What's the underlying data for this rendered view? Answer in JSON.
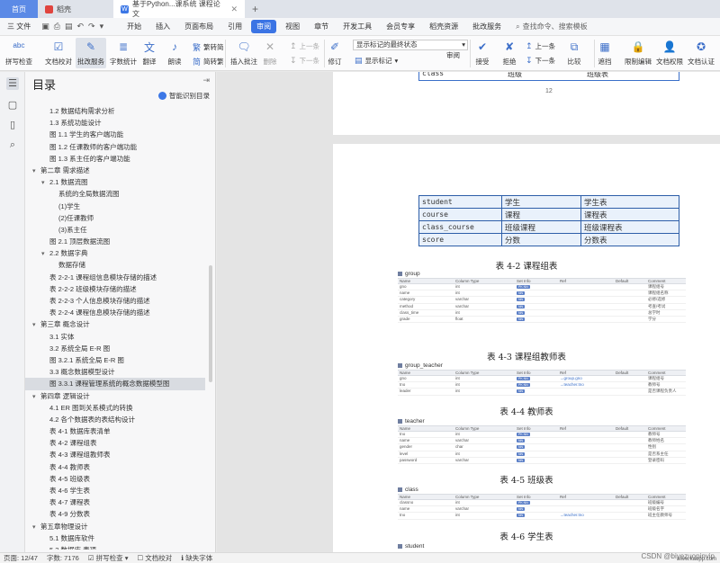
{
  "tabs": {
    "home": "首页",
    "shell": "稻壳",
    "doc": "基于Python...课系统 课程论文"
  },
  "menu": {
    "file": "三 文件",
    "items": [
      "开始",
      "插入",
      "页面布局",
      "引用",
      "审阅",
      "视图",
      "章节",
      "开发工具",
      "会员专享",
      "稻壳资源",
      "批改服务"
    ],
    "active_index": 4,
    "search": "查找命令、搜索模板"
  },
  "ribbon": {
    "spell": "拼写检查",
    "proof": "文档校对",
    "review_service": "批改服务",
    "word_count": "字数统计",
    "translate": "翻译",
    "read": "朗读",
    "trad": "繁转简",
    "simp": "简转繁",
    "insert_comment": "插入批注",
    "delete": "删除",
    "prev": "上一条",
    "next": "下一条",
    "revise": "修订",
    "display_select": "显示标记的最终状态",
    "show_marks": "显示标记",
    "review": "审阅",
    "accept": "接受",
    "reject": "拒绝",
    "prev2": "上一条",
    "next2": "下一条",
    "compare": "比较",
    "mask": "遮挡",
    "limit_edit": "限制编辑",
    "doc_permission": "文档权限",
    "doc_cert": "文档认证"
  },
  "toc": {
    "title": "目录",
    "smart": "智能识别目录",
    "items": [
      {
        "text": "1.2 数据结构需求分析",
        "level": 2,
        "arrow": ""
      },
      {
        "text": "1.3 系统功能设计",
        "level": 2,
        "arrow": ""
      },
      {
        "text": "图 1.1 学生的客户端功能",
        "level": 2,
        "arrow": ""
      },
      {
        "text": "图 1.2 任课教师的客户端功能",
        "level": 2,
        "arrow": ""
      },
      {
        "text": "图 1.3 系主任的客户端功能",
        "level": 2,
        "arrow": ""
      },
      {
        "text": "第二章 需求描述",
        "level": 1,
        "arrow": "▾"
      },
      {
        "text": "2.1 数据流图",
        "level": 2,
        "arrow": "▾"
      },
      {
        "text": "系统的全局数据流图",
        "level": 3,
        "arrow": ""
      },
      {
        "text": "(1)学生",
        "level": 3,
        "arrow": ""
      },
      {
        "text": "(2)任课教师",
        "level": 3,
        "arrow": ""
      },
      {
        "text": "(3)系主任",
        "level": 3,
        "arrow": ""
      },
      {
        "text": "图 2.1 顶层数据流图",
        "level": 2,
        "arrow": ""
      },
      {
        "text": "2.2 数据字典",
        "level": 2,
        "arrow": "▾"
      },
      {
        "text": "数据存储",
        "level": 3,
        "arrow": ""
      },
      {
        "text": "表 2-2-1 课程组信息模块存储的描述",
        "level": 2,
        "arrow": ""
      },
      {
        "text": "表 2-2-2 班级模块存储的描述",
        "level": 2,
        "arrow": ""
      },
      {
        "text": "表 2-2-3 个人信息模块存储的描述",
        "level": 2,
        "arrow": ""
      },
      {
        "text": "表 2-2-4 课程信息模块存储的描述",
        "level": 2,
        "arrow": ""
      },
      {
        "text": "第三章 概念设计",
        "level": 1,
        "arrow": "▾"
      },
      {
        "text": "3.1 实体",
        "level": 2,
        "arrow": ""
      },
      {
        "text": "3.2 系统全局 E-R 图",
        "level": 2,
        "arrow": ""
      },
      {
        "text": "图 3.2.1 系统全局 E-R 图",
        "level": 2,
        "arrow": ""
      },
      {
        "text": "3.3 概念数据模型设计",
        "level": 2,
        "arrow": ""
      },
      {
        "text": "图 3.3.1 课程管理系统的概念数据模型图",
        "level": 2,
        "arrow": "",
        "selected": true
      },
      {
        "text": "第四章 逻辑设计",
        "level": 1,
        "arrow": "▾"
      },
      {
        "text": "4.1 ER 图到关系模式的转换",
        "level": 2,
        "arrow": ""
      },
      {
        "text": "4.2 各个数据表的表结构设计",
        "level": 2,
        "arrow": ""
      },
      {
        "text": "表 4-1 数据库表清单",
        "level": 2,
        "arrow": ""
      },
      {
        "text": "表 4-2 课程组表",
        "level": 2,
        "arrow": ""
      },
      {
        "text": "表 4-3 课程组教师表",
        "level": 2,
        "arrow": ""
      },
      {
        "text": "表 4-4 教师表",
        "level": 2,
        "arrow": ""
      },
      {
        "text": "表 4-5 班级表",
        "level": 2,
        "arrow": ""
      },
      {
        "text": "表 4-6 学生表",
        "level": 2,
        "arrow": ""
      },
      {
        "text": "表 4-7 课程表",
        "level": 2,
        "arrow": ""
      },
      {
        "text": "表 4-9 分数表",
        "level": 2,
        "arrow": ""
      },
      {
        "text": "第五章物理设计",
        "level": 1,
        "arrow": "▾"
      },
      {
        "text": "5.1 数据库软件",
        "level": 2,
        "arrow": ""
      },
      {
        "text": "5.2 数据库 表项",
        "level": 2,
        "arrow": ""
      }
    ]
  },
  "doc": {
    "page_number": "12",
    "top_partial": [
      "class",
      "班级",
      "班级表"
    ],
    "table_rows": [
      [
        "student",
        "学生",
        "学生表"
      ],
      [
        "course",
        "课程",
        "课程表"
      ],
      [
        "class_course",
        "班级课程",
        "班级课程表"
      ],
      [
        "score",
        "分数",
        "分数表"
      ]
    ],
    "captions": {
      "c42": "表 4-2 课程组表",
      "c43": "表 4-3 课程组教师表",
      "c44": "表 4-4 教师表",
      "c45": "表 4-5 班级表",
      "c46": "表 4-6 学生表"
    },
    "schemas": [
      {
        "name": "group",
        "head": [
          "Name",
          "Column Type",
          "Set Info",
          "Ref",
          "Default",
          "Comment"
        ],
        "rows": [
          [
            "gno",
            "int",
            "PK NN",
            "",
            "",
            "课程组号"
          ],
          [
            "name",
            "int",
            "NN",
            "",
            "",
            "课程组名称"
          ],
          [
            "category",
            "varchar",
            "NN",
            "",
            "",
            "必修/选修"
          ],
          [
            "method",
            "varchar",
            "NN",
            "",
            "",
            "考查/考试"
          ],
          [
            "class_time",
            "int",
            "NN",
            "",
            "",
            "总学时"
          ],
          [
            "grade",
            "float",
            "NN",
            "",
            "",
            "学分"
          ]
        ]
      },
      {
        "name": "group_teacher",
        "head": [
          "Name",
          "Column Type",
          "Set Info",
          "Ref",
          "Default",
          "Comment"
        ],
        "rows": [
          [
            "gno",
            "int",
            "PK NN",
            "→group.gno",
            "",
            "课程组号"
          ],
          [
            "tno",
            "int",
            "PK NN",
            "→teacher.tno",
            "",
            "教师号"
          ],
          [
            "leader",
            "int",
            "NN",
            "",
            "",
            "是否课程负责人"
          ]
        ]
      },
      {
        "name": "teacher",
        "head": [
          "Name",
          "Column Type",
          "Set Info",
          "Ref",
          "Default",
          "Comment"
        ],
        "rows": [
          [
            "tno",
            "int",
            "PK NN",
            "",
            "",
            "教师号"
          ],
          [
            "name",
            "varchar",
            "NN",
            "",
            "",
            "教师姓名"
          ],
          [
            "gender",
            "char",
            "NN",
            "",
            "",
            "性别"
          ],
          [
            "level",
            "int",
            "NN",
            "",
            "",
            "是否系主任"
          ],
          [
            "password",
            "varchar",
            "NN",
            "",
            "",
            "登录密码"
          ]
        ]
      },
      {
        "name": "class",
        "head": [
          "Name",
          "Column Type",
          "Set Info",
          "Ref",
          "Default",
          "Comment"
        ],
        "rows": [
          [
            "classno",
            "int",
            "PK NN",
            "",
            "",
            "班级编号"
          ],
          [
            "name",
            "varchar",
            "NN",
            "",
            "",
            "班级名字"
          ],
          [
            "tno",
            "int",
            "NN",
            "→teacher.tno",
            "",
            "班主任教师号"
          ]
        ]
      }
    ],
    "schema_student": "student"
  },
  "status": {
    "page": "页面: 12/47",
    "words": "字数: 7176",
    "spell": "拼写检查",
    "proof": "文档校对",
    "font": "缺失字体"
  },
  "watermark": "CSDN @biyezuopinvip",
  "watermark2": "www.kaopp.com"
}
